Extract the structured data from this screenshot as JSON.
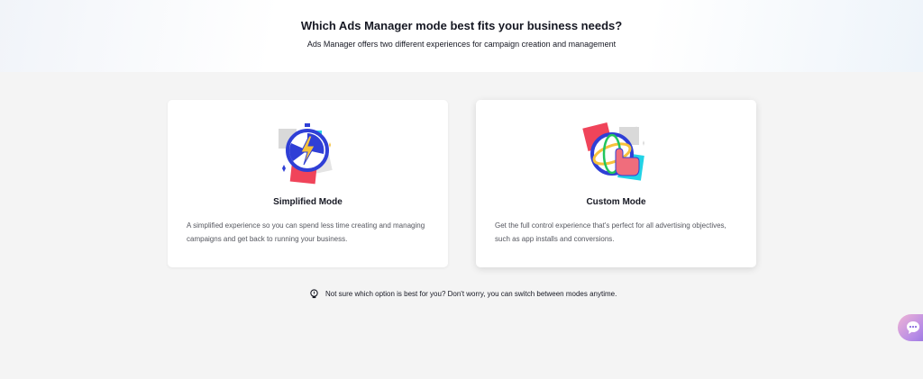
{
  "hero": {
    "title": "Which Ads Manager mode best fits your business needs?",
    "subtitle": "Ads Manager offers two different experiences for campaign creation and management"
  },
  "cards": [
    {
      "title": "Simplified Mode",
      "description": "A simplified experience so you can spend less time creating and managing campaigns and get back to running your business.",
      "icon": "stopwatch-lightning-icon"
    },
    {
      "title": "Custom Mode",
      "description": "Get the full control experience that's perfect for all advertising objectives, such as app installs and conversions.",
      "icon": "globe-hand-cursor-icon"
    }
  ],
  "hint": {
    "text": "Not sure which option is best for you? Don't worry, you can switch between modes anytime.",
    "icon": "lightbulb-icon"
  },
  "chat": {
    "icon": "chat-bubble-icon"
  },
  "colors": {
    "background": "#f4f4f4",
    "card": "#ffffff",
    "text": "#161823",
    "muted": "#55575f",
    "accent_blue": "#2f3fd6",
    "accent_red": "#f0445a",
    "accent_cyan": "#22d3e6",
    "accent_yellow": "#f6c23c"
  }
}
